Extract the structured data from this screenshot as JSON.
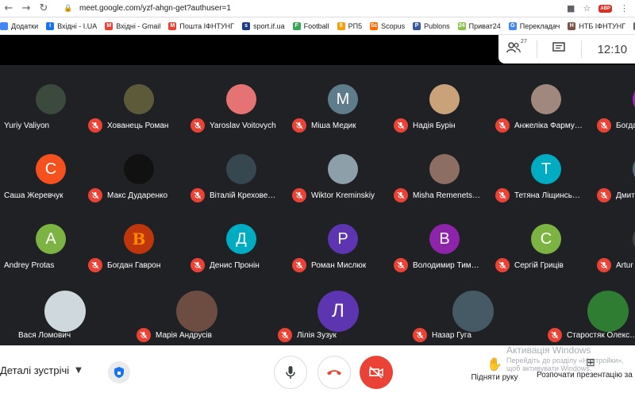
{
  "browser": {
    "url": "meet.google.com/yzf-ahgn-get?authuser=1",
    "bookmarks": [
      {
        "label": "Додатки",
        "color": "#4285f4",
        "glyph": ""
      },
      {
        "label": "Вхідні - I.UA",
        "color": "#1a73e8",
        "glyph": "i"
      },
      {
        "label": "Вхідні - Gmail",
        "color": "#ea4335",
        "glyph": "M"
      },
      {
        "label": "Пошта ІФНТУНГ",
        "color": "#ea4335",
        "glyph": "M"
      },
      {
        "label": "sport.if.ua",
        "color": "#1e3a8a",
        "glyph": "s"
      },
      {
        "label": "Football",
        "color": "#34a853",
        "glyph": "F"
      },
      {
        "label": "РП5",
        "color": "#f59e0b",
        "glyph": "5"
      },
      {
        "label": "Scopus",
        "color": "#ff6d00",
        "glyph": "Sc"
      },
      {
        "label": "Publons",
        "color": "#3b5998",
        "glyph": "P"
      },
      {
        "label": "Приват24",
        "color": "#8bc34a",
        "glyph": "24"
      },
      {
        "label": "Перекладач",
        "color": "#4285f4",
        "glyph": "G"
      },
      {
        "label": "НТБ ІФНТУНГ",
        "color": "#795548",
        "glyph": "Н"
      },
      {
        "label": "db.",
        "color": "#5f6368",
        "glyph": "d"
      }
    ]
  },
  "meet": {
    "people_count": "27",
    "time": "12:10",
    "participants": [
      {
        "name": "Yuriy Valiyon",
        "initial": "",
        "color": "#3b4a3c",
        "muted": false,
        "col": 0,
        "row": 0
      },
      {
        "name": "Хованець Роман",
        "initial": "",
        "color": "#5d5a3a",
        "muted": true,
        "col": 1,
        "row": 0
      },
      {
        "name": "Yaroslav Voitovych",
        "initial": "",
        "color": "#e57373",
        "muted": true,
        "col": 2,
        "row": 0
      },
      {
        "name": "Міша Медик",
        "initial": "М",
        "color": "#5f7c8a",
        "muted": true,
        "col": 3,
        "row": 0
      },
      {
        "name": "Надія Бурін",
        "initial": "",
        "color": "#c9a27a",
        "muted": true,
        "col": 4,
        "row": 0
      },
      {
        "name": "Анжеліка Фарму…",
        "initial": "",
        "color": "#a1887f",
        "muted": true,
        "col": 5,
        "row": 0
      },
      {
        "name": "Богда…",
        "initial": "",
        "color": "#9c27b0",
        "muted": true,
        "col": 6,
        "row": 0
      },
      {
        "name": "Саша Жеревчук",
        "initial": "С",
        "color": "#f4511e",
        "muted": false,
        "col": 0,
        "row": 1
      },
      {
        "name": "Макс Дударенко",
        "initial": "",
        "color": "#111111",
        "muted": true,
        "col": 1,
        "row": 1
      },
      {
        "name": "Віталій Крехове…",
        "initial": "",
        "color": "#37474f",
        "muted": true,
        "col": 2,
        "row": 1
      },
      {
        "name": "Wiktor Kreminskiy",
        "initial": "",
        "color": "#8d9fa8",
        "muted": true,
        "col": 3,
        "row": 1
      },
      {
        "name": "Misha Remenets…",
        "initial": "",
        "color": "#8d6e63",
        "muted": true,
        "col": 4,
        "row": 1
      },
      {
        "name": "Тетяна Ліщинсь…",
        "initial": "Т",
        "color": "#00acc1",
        "muted": true,
        "col": 5,
        "row": 1
      },
      {
        "name": "Дмит…",
        "initial": "",
        "color": "#546e7a",
        "muted": true,
        "col": 6,
        "row": 1
      },
      {
        "name": "Andrey Protas",
        "initial": "А",
        "color": "#7cb342",
        "muted": false,
        "col": 0,
        "row": 2
      },
      {
        "name": "Богдан Гаврон",
        "initial": "B",
        "color": "#bf360c",
        "muted": true,
        "col": 1,
        "row": 2
      },
      {
        "name": "Денис Пронін",
        "initial": "Д",
        "color": "#00acc1",
        "muted": true,
        "col": 2,
        "row": 2
      },
      {
        "name": "Роман Мислюк",
        "initial": "Р",
        "color": "#5e35b1",
        "muted": true,
        "col": 3,
        "row": 2
      },
      {
        "name": "Володимир Тим…",
        "initial": "В",
        "color": "#8e24aa",
        "muted": true,
        "col": 4,
        "row": 2
      },
      {
        "name": "Сергій Гриців",
        "initial": "С",
        "color": "#7cb342",
        "muted": true,
        "col": 5,
        "row": 2
      },
      {
        "name": "Artur I…",
        "initial": "",
        "color": "#424242",
        "muted": true,
        "col": 6,
        "row": 2
      },
      {
        "name": "Вася Ломович",
        "initial": "",
        "color": "#cfd8dc",
        "muted": false,
        "col": 0,
        "row": 3
      },
      {
        "name": "Марія Андрусів",
        "initial": "",
        "color": "#6d4c41",
        "muted": true,
        "col": 1,
        "row": 3
      },
      {
        "name": "Лілія Зузук",
        "initial": "Л",
        "color": "#5e35b1",
        "muted": true,
        "col": 2,
        "row": 3
      },
      {
        "name": "Назар Гуга",
        "initial": "",
        "color": "#455a64",
        "muted": true,
        "col": 3,
        "row": 3
      },
      {
        "name": "Старостяк Олекс…",
        "initial": "",
        "color": "#2e7d32",
        "muted": true,
        "col": 4,
        "row": 3
      }
    ]
  },
  "bottom": {
    "details_label": "Деталі зустрічі",
    "raise_hand_label": "Підняти руку",
    "present_label": "Розпочати презентацію за",
    "watermark_title": "Активація Windows",
    "watermark_line1": "Перейдіть до розділу «Настройки»,",
    "watermark_line2": "щоб активувати Windows."
  },
  "colors": {
    "grid_bg": "#202124",
    "mute_red": "#ea4335",
    "camera_off_red": "#ea4335",
    "hangup_red": "#ea4335"
  }
}
